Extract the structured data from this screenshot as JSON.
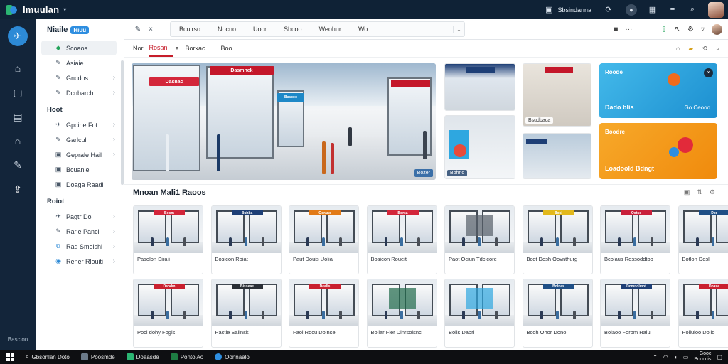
{
  "app": {
    "name": "Imuulan",
    "store_label": "Sbsindanna",
    "colors": {
      "titlebar": "#0f2236",
      "accent": "#2e8ee0",
      "active_tab": "#c61d2a"
    }
  },
  "rail": {
    "icons": [
      "pin-icon",
      "store-icon",
      "edit-icon",
      "archive-icon",
      "building-icon",
      "tools-icon",
      "upload-icon"
    ],
    "bottom_label": "Basclon"
  },
  "sidebar": {
    "title": "Niaile",
    "badge": "Hiuu",
    "items_top": [
      {
        "label": "Scoaos",
        "icon": "leaf-icon",
        "arrow": false,
        "active": true
      },
      {
        "label": "Asiaie",
        "icon": "pen-icon",
        "arrow": false
      },
      {
        "label": "Gncdos",
        "icon": "pen-icon",
        "arrow": true
      },
      {
        "label": "Dcnbarch",
        "icon": "pen-icon",
        "arrow": true
      }
    ],
    "section1": "Hoot",
    "items_mid": [
      {
        "label": "Gpcine Fot",
        "icon": "pin-icon",
        "arrow": true
      },
      {
        "label": "Garlculi",
        "icon": "pen-icon",
        "arrow": true
      },
      {
        "label": "Geprale Hail",
        "icon": "image-icon",
        "arrow": true
      },
      {
        "label": "Bcuanie",
        "icon": "image-icon",
        "arrow": false
      },
      {
        "label": "Doaga Raadi",
        "icon": "image-icon",
        "arrow": false
      }
    ],
    "section2": "Roiot",
    "items_bottom": [
      {
        "label": "Pagtr Do",
        "icon": "pin-icon",
        "arrow": true
      },
      {
        "label": "Rarie Pancil",
        "icon": "pen-icon",
        "arrow": true
      },
      {
        "label": "Rad Smolshi",
        "icon": "link-icon",
        "arrow": true
      },
      {
        "label": "Rener Rlouiti",
        "icon": "globe-icon",
        "arrow": true
      }
    ]
  },
  "toolbar": {
    "tabs": [
      "Bcuirso",
      "Nocno",
      "Uocr",
      "Sbcoo",
      "Weohur",
      "Wo"
    ]
  },
  "filterbar": {
    "items": [
      "Nor",
      "Rosan",
      "Borkac",
      "Boo"
    ],
    "active_index": 1
  },
  "hero": {
    "signs": [
      "Dasnac",
      "Dasmnek",
      "Bascoo"
    ],
    "badge": "Bozer"
  },
  "thumbs": [
    {
      "caption": ""
    },
    {
      "caption": "Bohno"
    },
    {
      "caption": "Bsudbaca"
    },
    {
      "caption": ""
    }
  ],
  "promos": [
    {
      "title": "Roode",
      "bottom": "Dado blis",
      "right": "Go Ceooo",
      "color": "#2ea7e0"
    },
    {
      "title": "Boodre",
      "bottom": "Loadoold Bdngt",
      "right": "",
      "color": "#f2a01b"
    }
  ],
  "section": {
    "title": "Mnoan Mali1 Raoos"
  },
  "cards_row1": [
    {
      "label": "Pasolon Sirali",
      "sign": "Bosm",
      "sign_color": "#d3263a"
    },
    {
      "label": "Bosicon Roiat",
      "sign": "Buhba",
      "sign_color": "#1e3f76"
    },
    {
      "label": "Paut Douis Uolia",
      "sign": "Ooranc",
      "sign_color": "#e27a16"
    },
    {
      "label": "Bosicon Roueit",
      "sign": "Borsa",
      "sign_color": "#d3263a"
    },
    {
      "label": "Paot Ociun Tdcicore",
      "sign": "",
      "sign_color": "#555e68"
    },
    {
      "label": "Bcot Dosh Oovnthurg",
      "sign": "Bosl",
      "sign_color": "#e2b81b"
    },
    {
      "label": "Bcolaus Rossoddtoo",
      "sign": "Ootse",
      "sign_color": "#c9203a"
    },
    {
      "label": "Botlon Dosl",
      "sign": "Dor",
      "sign_color": "#1f4f86"
    }
  ],
  "cards_row2": [
    {
      "label": "Pocl dohy Fogls",
      "sign": "Dabdm",
      "sign_color": "#c9202f"
    },
    {
      "label": "Pactie Salinsk",
      "sign": "Bisseae",
      "sign_color": "#2a2f36"
    },
    {
      "label": "Faol Rdcu Doinse",
      "sign": "Dealls",
      "sign_color": "#c9202f"
    },
    {
      "label": "Bollar Fler Dinrsolsnc",
      "sign": "",
      "sign_color": "#1f6a4a"
    },
    {
      "label": "Bolis Dabrl",
      "sign": "",
      "sign_color": "#2ea7e0"
    },
    {
      "label": "Bcoh Ohor Dono",
      "sign": "Bolnes",
      "sign_color": "#1f4f86"
    },
    {
      "label": "Bolaoo Forom Ralu",
      "sign": "Domnolmot",
      "sign_color": "#1e3f76"
    },
    {
      "label": "Polluloo Dolio",
      "sign": "Doase",
      "sign_color": "#c9202f"
    }
  ],
  "taskbar": {
    "search": "Gbsonlan Doto",
    "items": [
      "Poosmde",
      "Doaasde",
      "Ponto Ao",
      "Oonnaalo"
    ],
    "clock_top": "Gooc",
    "clock_bottom": "Bcoccis"
  }
}
